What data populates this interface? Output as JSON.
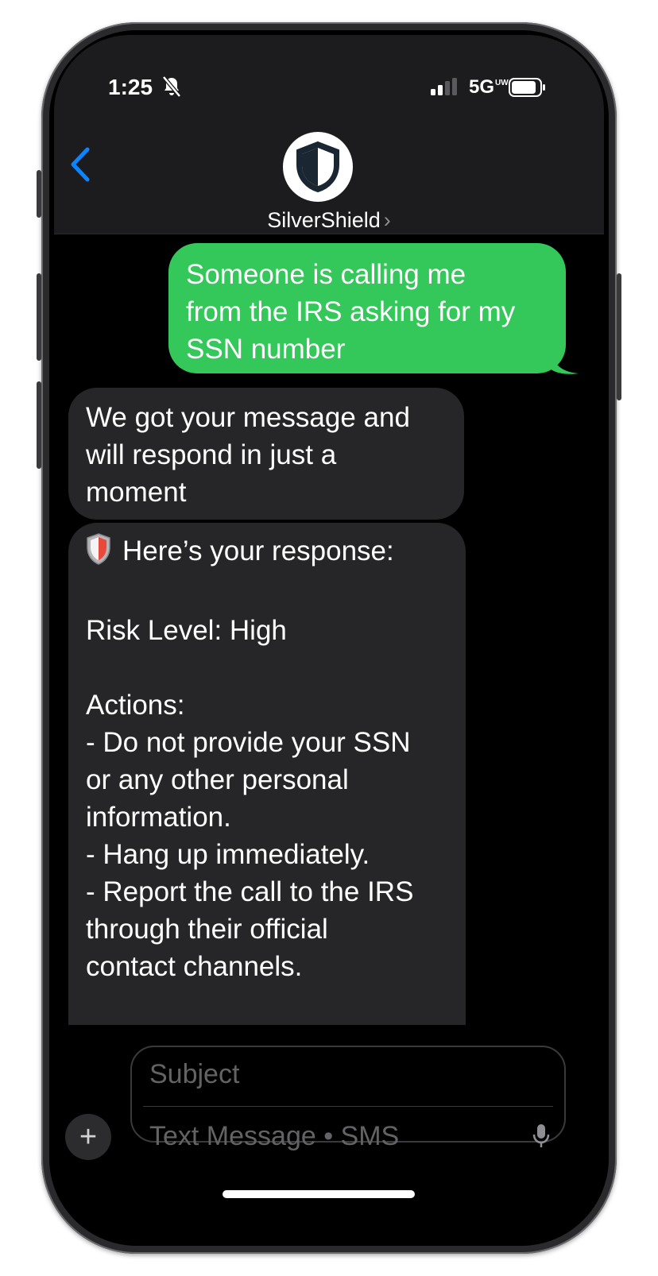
{
  "status_bar": {
    "time": "1:25",
    "network": "5G",
    "network_suffix": "UW",
    "icons": [
      "bell-slash-icon",
      "signal-icon",
      "battery-icon"
    ]
  },
  "header": {
    "contact_name": "SilverShield",
    "chevron": "›",
    "back_icon": "chevron-left-icon",
    "avatar_icon": "shield-icon"
  },
  "messages": [
    {
      "direction": "sent",
      "text": "Someone is calling me\nfrom the IRS asking for my\nSSN number"
    },
    {
      "direction": "received",
      "text": "We got your message and\nwill respond in just a\nmoment"
    },
    {
      "direction": "received",
      "emoji": "shield-emoji-icon",
      "text": "Here’s your response:\n\nRisk Level: High\n\nActions:\n- Do not provide your SSN\nor any other personal\ninformation.\n- Hang up immediately.\n- Report the call to the IRS\nthrough their official\ncontact channels."
    }
  ],
  "compose": {
    "plus_label": "+",
    "subject_placeholder": "Subject",
    "message_placeholder": "Text Message • SMS",
    "mic_icon": "microphone-icon"
  },
  "colors": {
    "sent_bubble": "#34c759",
    "received_bubble": "#262628",
    "accent": "#0a84ff"
  }
}
